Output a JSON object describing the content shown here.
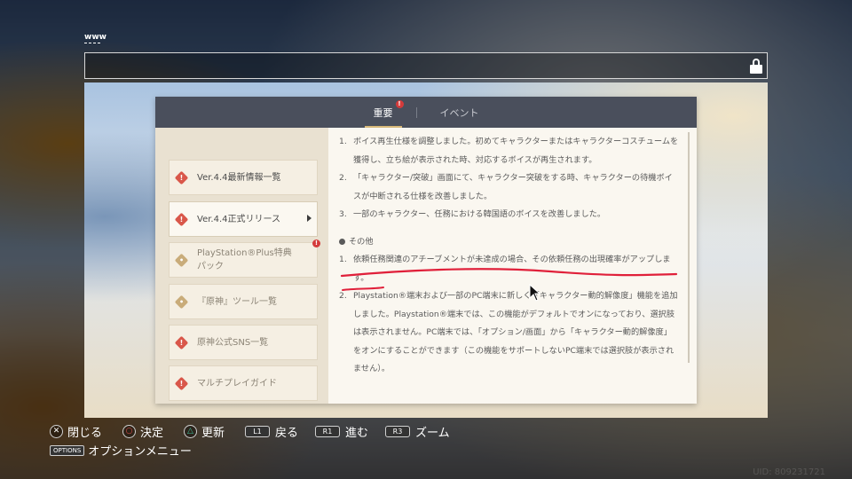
{
  "browser": {
    "www_label": "www"
  },
  "tabs": [
    {
      "label": "重要",
      "badge": "!"
    },
    {
      "label": "イベント"
    }
  ],
  "sidebar": {
    "items": [
      {
        "label": "Ver.4.4最新情報一覧",
        "icon": "red-diamond-alert-icon"
      },
      {
        "label": "Ver.4.4正式リリース",
        "icon": "red-diamond-alert-icon"
      },
      {
        "label": "PlayStation®Plus特典パック",
        "icon": "tan-diamond-icon",
        "badge": "!"
      },
      {
        "label": "『原神』ツール一覧",
        "icon": "tan-diamond-icon"
      },
      {
        "label": "原神公式SNS一覧",
        "icon": "red-diamond-alert-icon"
      },
      {
        "label": "マルチプレイガイド",
        "icon": "red-diamond-alert-icon"
      }
    ]
  },
  "content": {
    "list1": [
      {
        "num": "1.",
        "text": "ボイス再生仕様を調整しました。初めてキャラクターまたはキャラクターコスチュームを獲得し、立ち絵が表示された時、対応するボイスが再生されます。"
      },
      {
        "num": "2.",
        "text": "「キャラクター/突破」画面にて、キャラクター突破をする時、キャラクターの待機ボイスが中断される仕様を改善しました。"
      },
      {
        "num": "3.",
        "text": "一部のキャラクター、任務における韓国語のボイスを改善しました。"
      }
    ],
    "section": "その他",
    "list2": [
      {
        "num": "1.",
        "text": "依頼任務関連のアチーブメントが未達成の場合、その依頼任務の出現確率がアップします。"
      },
      {
        "num": "2.",
        "text": "Playstation®端末および一部のPC端末に新しく「キャラクター動的解像度」機能を追加しました。Playstation®端末では、この機能がデフォルトでオンになっており、選択肢は表示されません。PC端末では、「オプション/画面」から「キャラクター動的解像度」をオンにすることができます（この機能をサポートしないPC端末では選択肢が表示されません）。"
      }
    ]
  },
  "controls": [
    {
      "button": "✕",
      "label": "閉じる"
    },
    {
      "button": "○",
      "label": "決定"
    },
    {
      "button": "△",
      "label": "更新"
    },
    {
      "button": "L1",
      "label": "戻る"
    },
    {
      "button": "R1",
      "label": "進む"
    },
    {
      "button": "R3",
      "label": "ズーム"
    }
  ],
  "options": {
    "button": "OPTIONS",
    "label": "オプションメニュー"
  },
  "uid": "UID: 809231721",
  "colors": {
    "accent_red": "#d43b3b",
    "tab_bar": "#4a4f5c",
    "annotation": "#e0203a"
  }
}
